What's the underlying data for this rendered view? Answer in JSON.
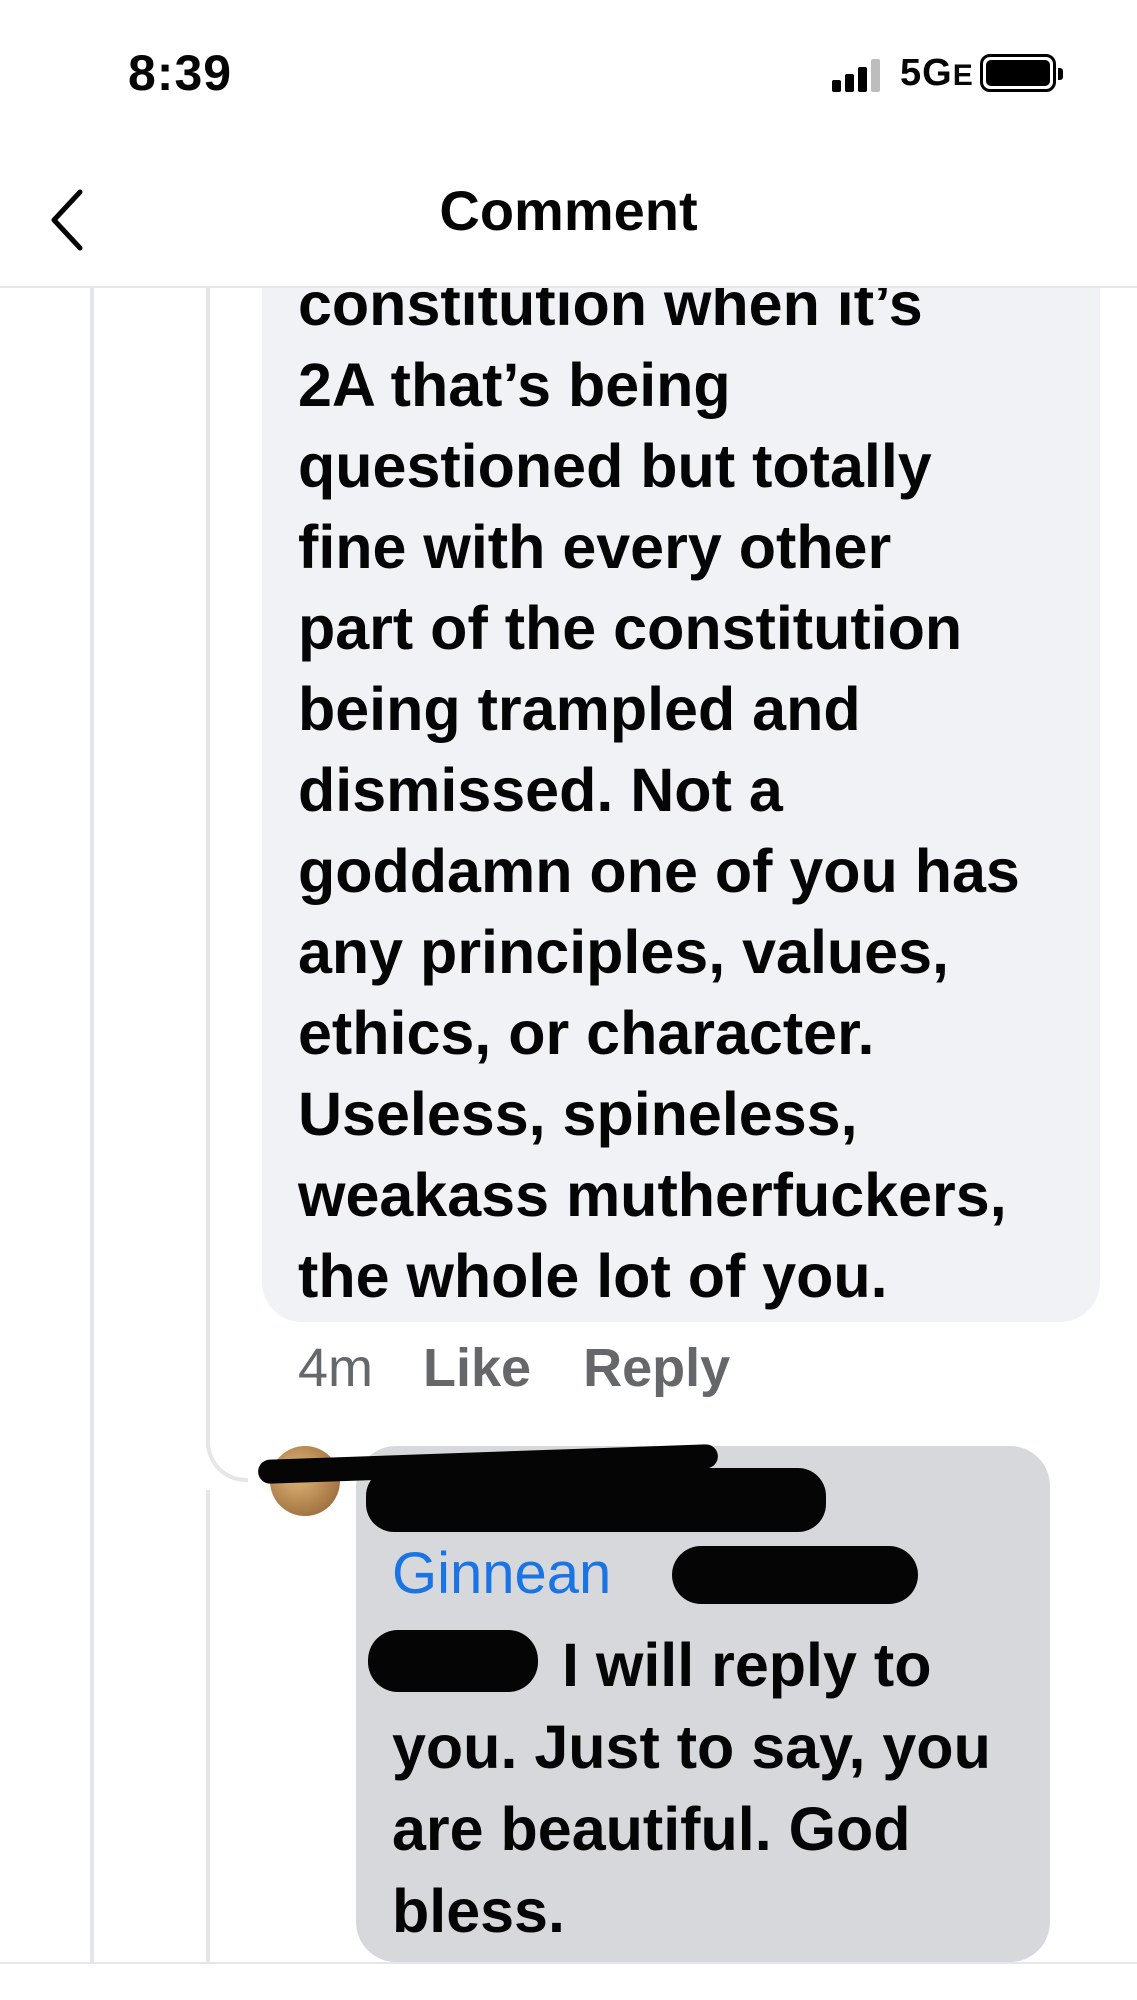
{
  "status_bar": {
    "time": "8:39",
    "network": "5G",
    "network_suffix": "E"
  },
  "header": {
    "title": "Comment",
    "back_icon": "chevron-left-icon"
  },
  "comment": {
    "text": "constitution when it’s\n2A that’s being\nquestioned but totally\nfine with every other\npart of the constitution\nbeing trampled and\ndismissed. Not a\ngoddamn one of you has\nany principles, values,\nethics, or character.\nUseless, spineless,\nweakass mutherfuckers,\nthe whole lot of you.",
    "time": "4m",
    "like_label": "Like",
    "reply_label": "Reply"
  },
  "reply": {
    "mention": "Ginnean",
    "text": "I will reply to\nyou. Just to say, you\nare beautiful. God\nbless."
  },
  "colors": {
    "bubble_main": "#f0f2f5",
    "bubble_reply": "#d7d8dc",
    "mention": "#1b74e4",
    "meta": "#65676b"
  }
}
